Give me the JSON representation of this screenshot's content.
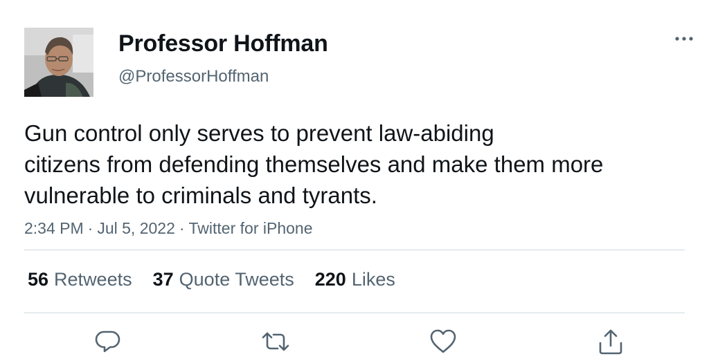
{
  "author": {
    "display_name": "Professor Hoffman",
    "handle": "@ProfessorHoffman"
  },
  "tweet": {
    "text_lines": [
      "Gun control only serves to prevent law-abiding",
      "citizens from defending themselves and make them more",
      "vulnerable to criminals and tyrants."
    ],
    "time": "2:34 PM",
    "separator": "·",
    "date": "Jul 5, 2022",
    "source": "Twitter for iPhone"
  },
  "stats": {
    "retweets": {
      "count": "56",
      "label": "Retweets"
    },
    "quotes": {
      "count": "37",
      "label": "Quote Tweets"
    },
    "likes": {
      "count": "220",
      "label": "Likes"
    }
  },
  "icons": {
    "more": "more-horizontal-icon",
    "reply": "reply-icon",
    "retweet": "retweet-icon",
    "like": "heart-icon",
    "share": "share-icon"
  },
  "colors": {
    "text_primary": "#0f1419",
    "text_secondary": "#536471",
    "divider": "#cfd9de"
  }
}
